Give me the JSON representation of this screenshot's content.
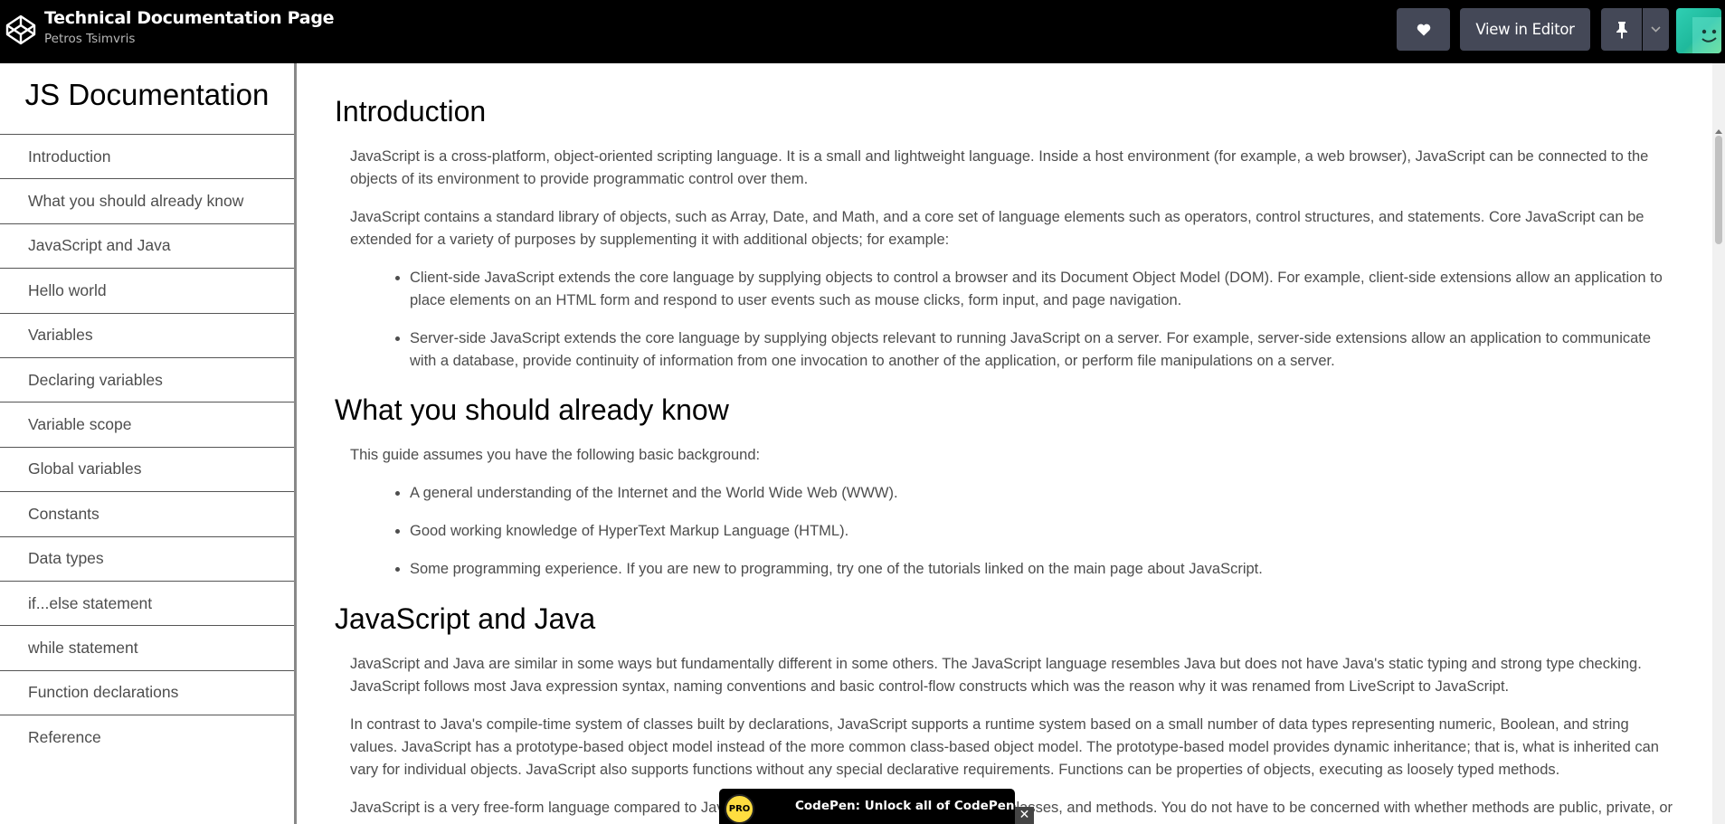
{
  "topbar": {
    "pen_title": "Technical Documentation Page",
    "author": "Petros Tsimvris",
    "logo_icon": "codepen-logo-icon",
    "heart_icon": "heart-icon",
    "view_in_editor_label": "View in Editor",
    "pin_icon": "pin-icon",
    "dropdown_icon": "chevron-down-icon",
    "avatar_icon": "avatar",
    "colors": {
      "bar": "#000000",
      "button": "#444857"
    }
  },
  "sidebar": {
    "title": "JS Documentation",
    "items": [
      {
        "label": "Introduction"
      },
      {
        "label": "What you should already know"
      },
      {
        "label": "JavaScript and Java"
      },
      {
        "label": "Hello world"
      },
      {
        "label": "Variables"
      },
      {
        "label": "Declaring variables"
      },
      {
        "label": "Variable scope"
      },
      {
        "label": "Global variables"
      },
      {
        "label": "Constants"
      },
      {
        "label": "Data types"
      },
      {
        "label": "if...else statement"
      },
      {
        "label": "while statement"
      },
      {
        "label": "Function declarations"
      },
      {
        "label": "Reference"
      }
    ]
  },
  "main": {
    "sections": [
      {
        "title": "Introduction",
        "paragraphs": [
          "JavaScript is a cross-platform, object-oriented scripting language. It is a small and lightweight language. Inside a host environment (for example, a web browser), JavaScript can be connected to the objects of its environment to provide programmatic control over them.",
          "JavaScript contains a standard library of objects, such as Array, Date, and Math, and a core set of language elements such as operators, control structures, and statements. Core JavaScript can be extended for a variety of purposes by supplementing it with additional objects; for example:"
        ],
        "bullets": [
          "Client-side JavaScript extends the core language by supplying objects to control a browser and its Document Object Model (DOM). For example, client-side extensions allow an application to place elements on an HTML form and respond to user events such as mouse clicks, form input, and page navigation.",
          "Server-side JavaScript extends the core language by supplying objects relevant to running JavaScript on a server. For example, server-side extensions allow an application to communicate with a database, provide continuity of information from one invocation to another of the application, or perform file manipulations on a server."
        ]
      },
      {
        "title": "What you should already know",
        "paragraphs": [
          "This guide assumes you have the following basic background:"
        ],
        "bullets": [
          "A general understanding of the Internet and the World Wide Web (WWW).",
          "Good working knowledge of HyperText Markup Language (HTML).",
          "Some programming experience. If you are new to programming, try one of the tutorials linked on the main page about JavaScript."
        ]
      },
      {
        "title": "JavaScript and Java",
        "paragraphs": [
          "JavaScript and Java are similar in some ways but fundamentally different in some others. The JavaScript language resembles Java but does not have Java's static typing and strong type checking. JavaScript follows most Java expression syntax, naming conventions and basic control-flow constructs which was the reason why it was renamed from LiveScript to JavaScript.",
          "In contrast to Java's compile-time system of classes built by declarations, JavaScript supports a runtime system based on a small number of data types representing numeric, Boolean, and string values. JavaScript has a prototype-based object model instead of the more common class-based object model. The prototype-based model provides dynamic inheritance; that is, what is inherited can vary for individual objects. JavaScript also supports functions without any special declarative requirements. Functions can be properties of objects, executing as loosely typed methods.",
          "JavaScript is a very free-form language compared to Java. You do not have to declare all variables, classes, and methods. You do not have to be concerned with whether methods are public, private, or protected, and you do not have to implement interfaces."
        ],
        "bullets": []
      }
    ]
  },
  "promo": {
    "badge": "PRO",
    "text": "CodePen: Unlock all of CodePen",
    "close": "✕"
  }
}
